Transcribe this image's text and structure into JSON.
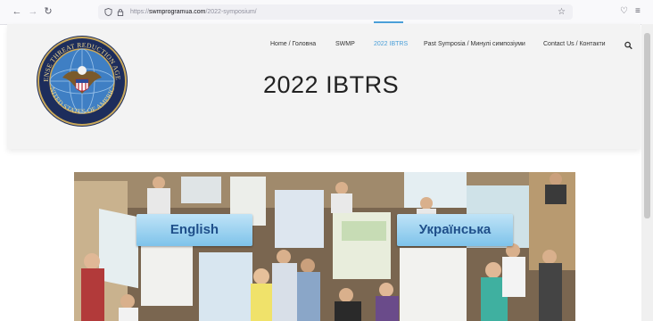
{
  "browser": {
    "url_prefix": "https://",
    "url_domain": "swmprogramua.com",
    "url_path": "/2022-symposium/",
    "back_icon": "←",
    "forward_icon": "→",
    "reload_icon": "↻",
    "bookmark_icon": "☆",
    "pocket_icon": "♡",
    "menu_icon": "≡"
  },
  "site": {
    "logo_text_top": "DEFENSE THREAT REDUCTION AGENCY",
    "logo_text_bottom": "UNITED STATES OF AMERICA",
    "nav": [
      {
        "label": "Home / Головна"
      },
      {
        "label": "SWMP"
      },
      {
        "label": "2022 IBTRS"
      },
      {
        "label": "Past Symposia / Минулі симпозіуми"
      },
      {
        "label": "Contact Us / Контакти"
      }
    ],
    "active_nav": "2022 IBTRS",
    "search_icon": "search-icon",
    "page_title": "2022 IBTRS"
  },
  "hero": {
    "english_button": "English",
    "ukrainian_button": "Українська"
  },
  "colors": {
    "accent": "#4a9fd8",
    "button_text": "#1f4f8a",
    "button_bg": "#9fd3f2"
  }
}
